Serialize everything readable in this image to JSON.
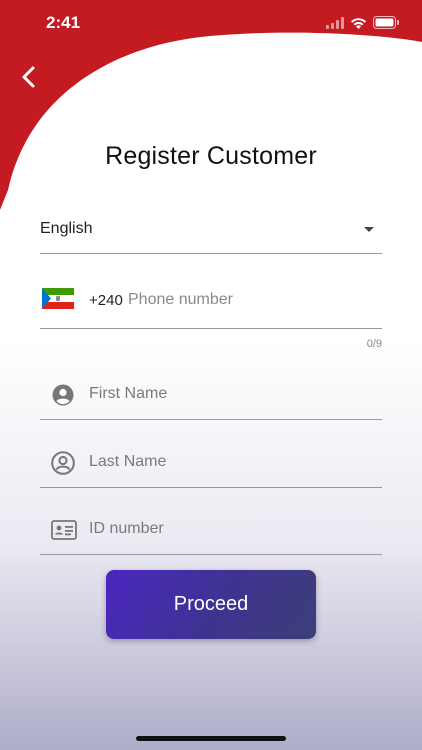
{
  "status_bar": {
    "time": "2:41",
    "icons": [
      "signal-icon",
      "wifi-icon",
      "battery-icon"
    ]
  },
  "header": {
    "title": "Register Customer",
    "back_icon": "chevron-left-icon",
    "accent_color": "#c41a21"
  },
  "language": {
    "selected": "English"
  },
  "phone": {
    "country_code": "+240",
    "placeholder": "Phone number",
    "counter": "0/9",
    "flag": "equatorial-guinea-flag"
  },
  "first_name": {
    "placeholder": "First Name",
    "icon": "person-filled-icon"
  },
  "last_name": {
    "placeholder": "Last Name",
    "icon": "person-outline-icon"
  },
  "id_number": {
    "placeholder": "ID number",
    "icon": "id-card-icon"
  },
  "proceed": {
    "label": "Proceed",
    "colors": [
      "#4a26c0",
      "#3d3e78"
    ]
  }
}
